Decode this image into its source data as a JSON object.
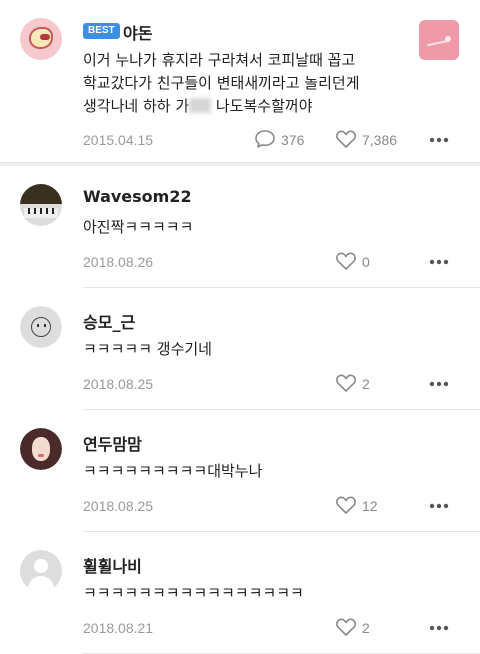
{
  "best_post": {
    "badge": "BEST",
    "author": "야돈",
    "text_lines": [
      "이거 누나가 휴지라 구라쳐서 코피날때 꼽고",
      "학교갔다가 친구들이 변태새끼라고 놀리던게",
      "생각나네 하하 가",
      " 나도복수할꺼야"
    ],
    "date": "2015.04.15",
    "comment_count": "376",
    "like_count": "7,386"
  },
  "comments": [
    {
      "author": "Wavesom22",
      "text": "아진짝ㅋㅋㅋㅋㅋ",
      "date": "2018.08.26",
      "likes": "0"
    },
    {
      "author": "승모_근",
      "text": "ㅋㅋㅋㅋㅋ 갱수기네",
      "date": "2018.08.25",
      "likes": "2"
    },
    {
      "author": "연두맘맘",
      "text": "ㅋㅋㅋㅋㅋㅋㅋㅋㅋ대박누나",
      "date": "2018.08.25",
      "likes": "12"
    },
    {
      "author": "휠휠나비",
      "text": "ㅋㅋㅋㅋㅋㅋㅋㅋㅋㅋㅋㅋㅋㅋㅋㅋ",
      "date": "2018.08.21",
      "likes": "2"
    }
  ],
  "icons": {
    "comment": "speech-bubble-icon",
    "like": "heart-icon",
    "more": "more-dots-icon"
  },
  "colors": {
    "badge": "#3d8fe6",
    "meta_text": "#9a9a9a",
    "divider": "#e5e5e5"
  }
}
